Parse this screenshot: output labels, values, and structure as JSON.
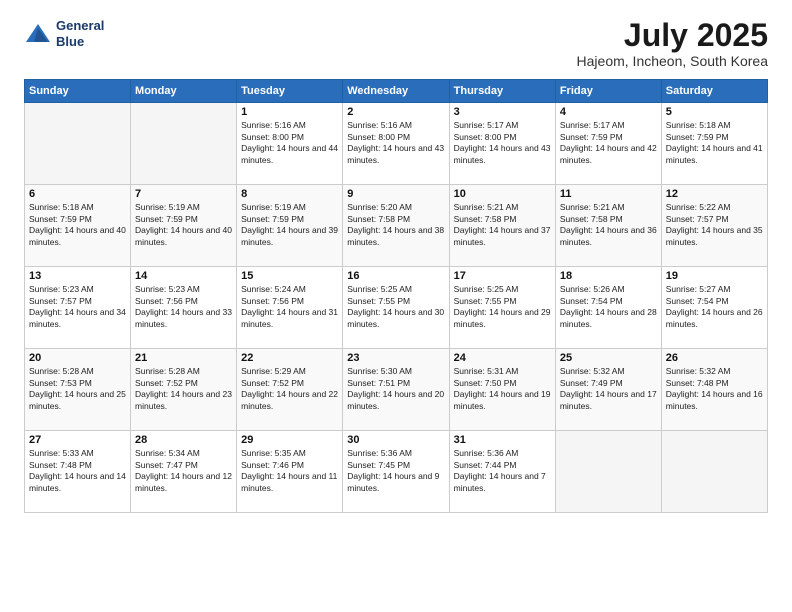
{
  "header": {
    "logo_line1": "General",
    "logo_line2": "Blue",
    "month_year": "July 2025",
    "location": "Hajeom, Incheon, South Korea"
  },
  "days_of_week": [
    "Sunday",
    "Monday",
    "Tuesday",
    "Wednesday",
    "Thursday",
    "Friday",
    "Saturday"
  ],
  "weeks": [
    [
      {
        "day": "",
        "empty": true
      },
      {
        "day": "",
        "empty": true
      },
      {
        "day": "1",
        "sunrise": "5:16 AM",
        "sunset": "8:00 PM",
        "daylight": "14 hours and 44 minutes."
      },
      {
        "day": "2",
        "sunrise": "5:16 AM",
        "sunset": "8:00 PM",
        "daylight": "14 hours and 43 minutes."
      },
      {
        "day": "3",
        "sunrise": "5:17 AM",
        "sunset": "8:00 PM",
        "daylight": "14 hours and 43 minutes."
      },
      {
        "day": "4",
        "sunrise": "5:17 AM",
        "sunset": "7:59 PM",
        "daylight": "14 hours and 42 minutes."
      },
      {
        "day": "5",
        "sunrise": "5:18 AM",
        "sunset": "7:59 PM",
        "daylight": "14 hours and 41 minutes."
      }
    ],
    [
      {
        "day": "6",
        "sunrise": "5:18 AM",
        "sunset": "7:59 PM",
        "daylight": "14 hours and 40 minutes."
      },
      {
        "day": "7",
        "sunrise": "5:19 AM",
        "sunset": "7:59 PM",
        "daylight": "14 hours and 40 minutes."
      },
      {
        "day": "8",
        "sunrise": "5:19 AM",
        "sunset": "7:59 PM",
        "daylight": "14 hours and 39 minutes."
      },
      {
        "day": "9",
        "sunrise": "5:20 AM",
        "sunset": "7:58 PM",
        "daylight": "14 hours and 38 minutes."
      },
      {
        "day": "10",
        "sunrise": "5:21 AM",
        "sunset": "7:58 PM",
        "daylight": "14 hours and 37 minutes."
      },
      {
        "day": "11",
        "sunrise": "5:21 AM",
        "sunset": "7:58 PM",
        "daylight": "14 hours and 36 minutes."
      },
      {
        "day": "12",
        "sunrise": "5:22 AM",
        "sunset": "7:57 PM",
        "daylight": "14 hours and 35 minutes."
      }
    ],
    [
      {
        "day": "13",
        "sunrise": "5:23 AM",
        "sunset": "7:57 PM",
        "daylight": "14 hours and 34 minutes."
      },
      {
        "day": "14",
        "sunrise": "5:23 AM",
        "sunset": "7:56 PM",
        "daylight": "14 hours and 33 minutes."
      },
      {
        "day": "15",
        "sunrise": "5:24 AM",
        "sunset": "7:56 PM",
        "daylight": "14 hours and 31 minutes."
      },
      {
        "day": "16",
        "sunrise": "5:25 AM",
        "sunset": "7:55 PM",
        "daylight": "14 hours and 30 minutes."
      },
      {
        "day": "17",
        "sunrise": "5:25 AM",
        "sunset": "7:55 PM",
        "daylight": "14 hours and 29 minutes."
      },
      {
        "day": "18",
        "sunrise": "5:26 AM",
        "sunset": "7:54 PM",
        "daylight": "14 hours and 28 minutes."
      },
      {
        "day": "19",
        "sunrise": "5:27 AM",
        "sunset": "7:54 PM",
        "daylight": "14 hours and 26 minutes."
      }
    ],
    [
      {
        "day": "20",
        "sunrise": "5:28 AM",
        "sunset": "7:53 PM",
        "daylight": "14 hours and 25 minutes."
      },
      {
        "day": "21",
        "sunrise": "5:28 AM",
        "sunset": "7:52 PM",
        "daylight": "14 hours and 23 minutes."
      },
      {
        "day": "22",
        "sunrise": "5:29 AM",
        "sunset": "7:52 PM",
        "daylight": "14 hours and 22 minutes."
      },
      {
        "day": "23",
        "sunrise": "5:30 AM",
        "sunset": "7:51 PM",
        "daylight": "14 hours and 20 minutes."
      },
      {
        "day": "24",
        "sunrise": "5:31 AM",
        "sunset": "7:50 PM",
        "daylight": "14 hours and 19 minutes."
      },
      {
        "day": "25",
        "sunrise": "5:32 AM",
        "sunset": "7:49 PM",
        "daylight": "14 hours and 17 minutes."
      },
      {
        "day": "26",
        "sunrise": "5:32 AM",
        "sunset": "7:48 PM",
        "daylight": "14 hours and 16 minutes."
      }
    ],
    [
      {
        "day": "27",
        "sunrise": "5:33 AM",
        "sunset": "7:48 PM",
        "daylight": "14 hours and 14 minutes."
      },
      {
        "day": "28",
        "sunrise": "5:34 AM",
        "sunset": "7:47 PM",
        "daylight": "14 hours and 12 minutes."
      },
      {
        "day": "29",
        "sunrise": "5:35 AM",
        "sunset": "7:46 PM",
        "daylight": "14 hours and 11 minutes."
      },
      {
        "day": "30",
        "sunrise": "5:36 AM",
        "sunset": "7:45 PM",
        "daylight": "14 hours and 9 minutes."
      },
      {
        "day": "31",
        "sunrise": "5:36 AM",
        "sunset": "7:44 PM",
        "daylight": "14 hours and 7 minutes."
      },
      {
        "day": "",
        "empty": true
      },
      {
        "day": "",
        "empty": true
      }
    ]
  ]
}
